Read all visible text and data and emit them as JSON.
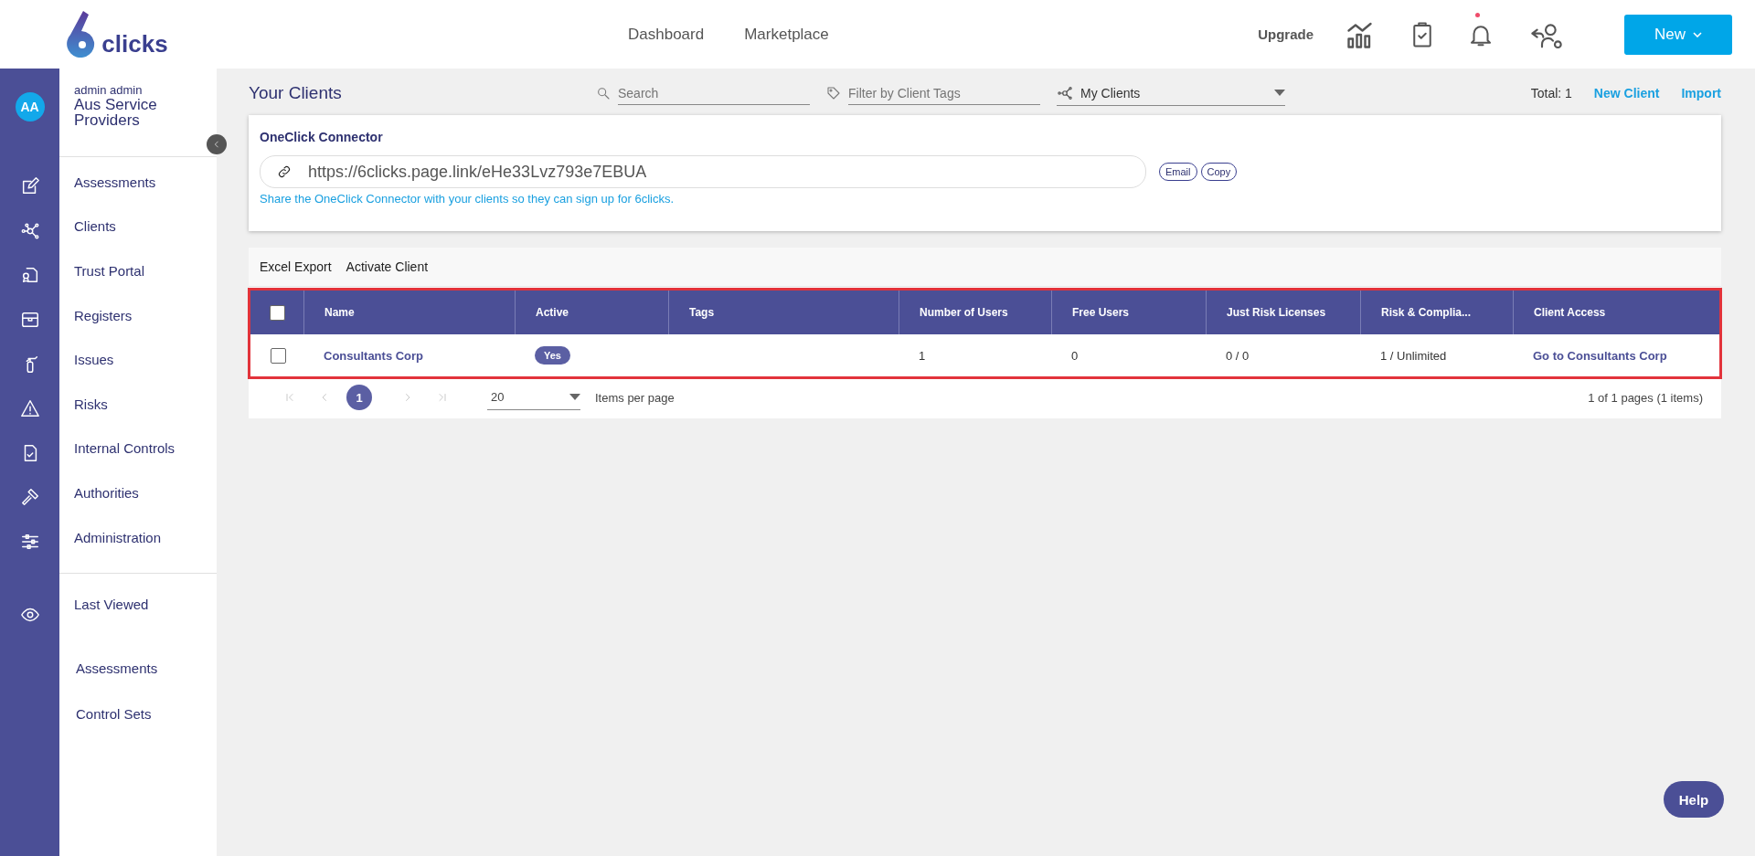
{
  "header": {
    "logo_text": "clicks",
    "nav": [
      "Dashboard",
      "Marketplace"
    ],
    "upgrade": "Upgrade",
    "notification_dot": true,
    "new_button": "New"
  },
  "sidebar": {
    "avatar": "AA",
    "user": "admin admin",
    "org": "Aus Service Providers",
    "items": [
      {
        "label": "Assessments"
      },
      {
        "label": "Clients"
      },
      {
        "label": "Trust Portal"
      },
      {
        "label": "Registers"
      },
      {
        "label": "Issues"
      },
      {
        "label": "Risks"
      },
      {
        "label": "Internal Controls"
      },
      {
        "label": "Authorities"
      },
      {
        "label": "Administration"
      }
    ],
    "last_viewed": "Last Viewed",
    "recent": [
      "Assessments",
      "Control Sets"
    ]
  },
  "toolbar": {
    "title": "Your Clients",
    "search": {
      "placeholder": "Search"
    },
    "tag_filter": {
      "placeholder": "Filter by Client Tags"
    },
    "client_select": {
      "value": "My Clients"
    },
    "total": "Total: 1",
    "links": [
      "New Client",
      "Import"
    ]
  },
  "connector": {
    "title": "OneClick Connector",
    "url": "https://6clicks.page.link/eHe33Lvz793e7EBUA",
    "buttons": [
      "Email",
      "Copy"
    ],
    "hint": "Share the OneClick Connector with your clients so they can sign up for 6clicks."
  },
  "table": {
    "actions": [
      "Excel Export",
      "Activate Client"
    ],
    "select_all_checked": false,
    "columns": [
      "Name",
      "Active",
      "Tags",
      "Number of Users",
      "Free Users",
      "Just Risk Licenses",
      "Risk & Complia...",
      "Client Access"
    ],
    "rows": [
      {
        "checked": false,
        "cells": [
          {
            "kind": "link",
            "text": "Consultants Corp"
          },
          {
            "kind": "badge",
            "text": "Yes"
          },
          {
            "kind": "empty"
          },
          {
            "kind": "text",
            "text": "1"
          },
          {
            "kind": "text",
            "text": "0"
          },
          {
            "kind": "text",
            "text": "0 / 0"
          },
          {
            "kind": "text",
            "text": "1 / Unlimited"
          },
          {
            "kind": "link",
            "text": "Go to Consultants Corp"
          }
        ]
      }
    ],
    "highlighted": true,
    "pagination": {
      "pages": [
        {
          "label": "1",
          "selected": true
        }
      ],
      "page_size": "20",
      "page_size_label": "Items per page",
      "summary": "1 of 1 pages (1 items)"
    }
  },
  "help_button": "Help"
}
